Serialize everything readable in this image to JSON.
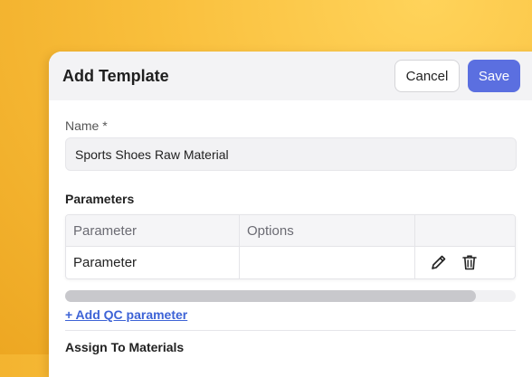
{
  "dialog": {
    "title": "Add Template",
    "cancel_label": "Cancel",
    "save_label": "Save"
  },
  "name_field": {
    "label": "Name *",
    "value": "Sports Shoes Raw Material"
  },
  "parameters": {
    "title": "Parameters",
    "columns": [
      "Parameter",
      "Options",
      ""
    ],
    "rows": [
      {
        "parameter": "Parameter",
        "options": ""
      }
    ],
    "row_actions": [
      "pencil-icon",
      "trash-icon"
    ],
    "add_link": "+ Add QC parameter"
  },
  "assign": {
    "title": "Assign To Materials"
  },
  "colors": {
    "primary": "#5b6fe0",
    "link": "#3d63d6",
    "background": "#f9bf3c"
  }
}
